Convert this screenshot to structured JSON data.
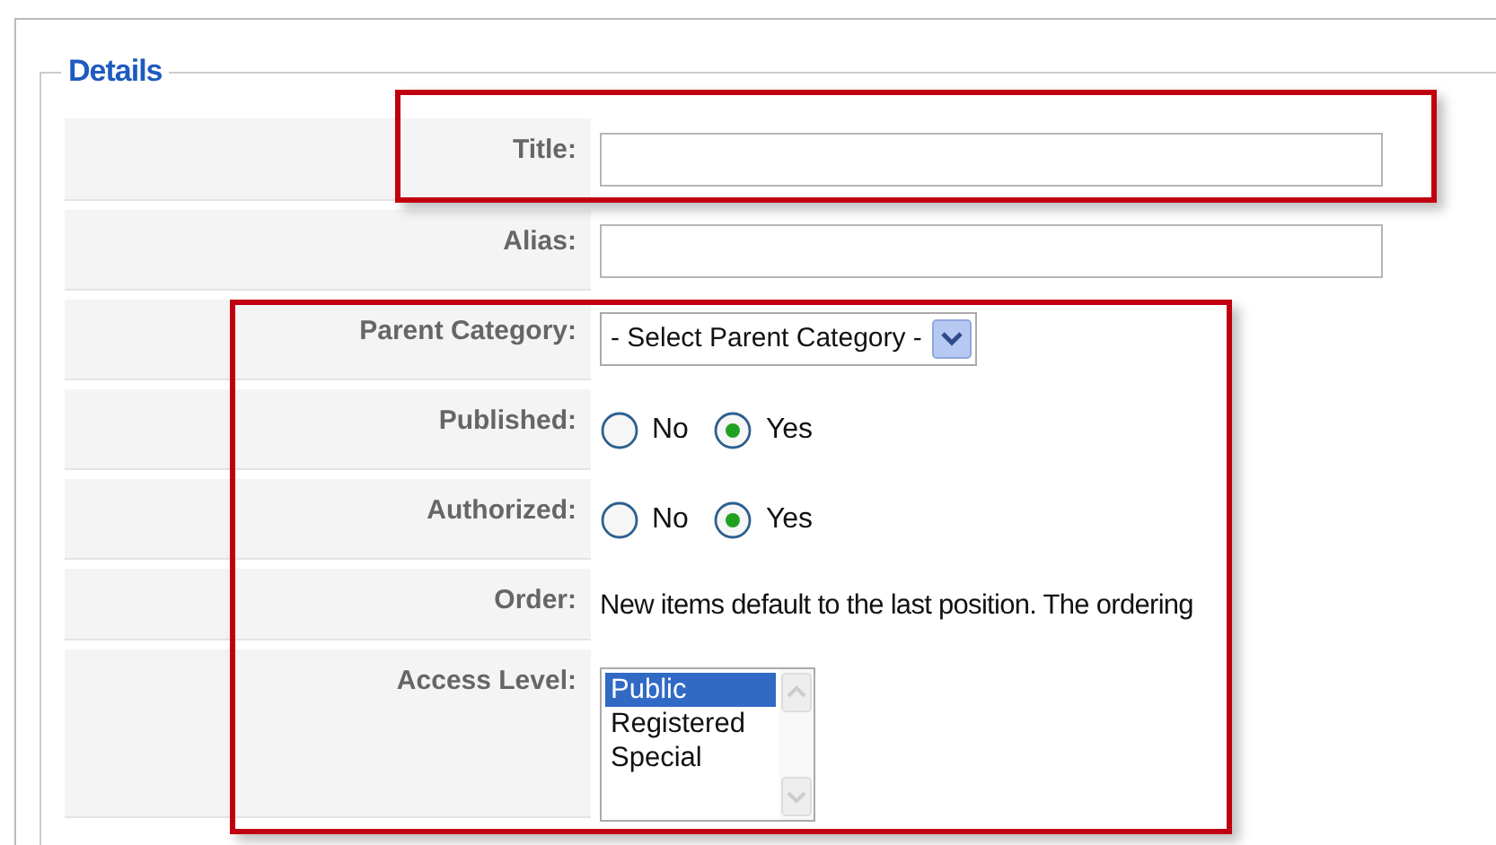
{
  "legend": "Details",
  "rows": [
    {
      "label": "Title:",
      "kind": "text"
    },
    {
      "label": "Alias:",
      "kind": "text"
    },
    {
      "label": "Parent Category:",
      "kind": "select",
      "value": "- Select Parent Category -"
    },
    {
      "label": "Published:",
      "kind": "radio",
      "options": [
        {
          "label": "No",
          "selected": false
        },
        {
          "label": "Yes",
          "selected": true
        }
      ]
    },
    {
      "label": "Authorized:",
      "kind": "radio",
      "options": [
        {
          "label": "No",
          "selected": false
        },
        {
          "label": "Yes",
          "selected": true
        }
      ]
    },
    {
      "label": "Order:",
      "kind": "note",
      "text": "New items default to the last position. The ordering"
    },
    {
      "label": "Access Level:",
      "kind": "listbox",
      "options": [
        {
          "label": "Public",
          "selected": true
        },
        {
          "label": "Registered",
          "selected": false
        },
        {
          "label": "Special",
          "selected": false
        }
      ]
    }
  ]
}
